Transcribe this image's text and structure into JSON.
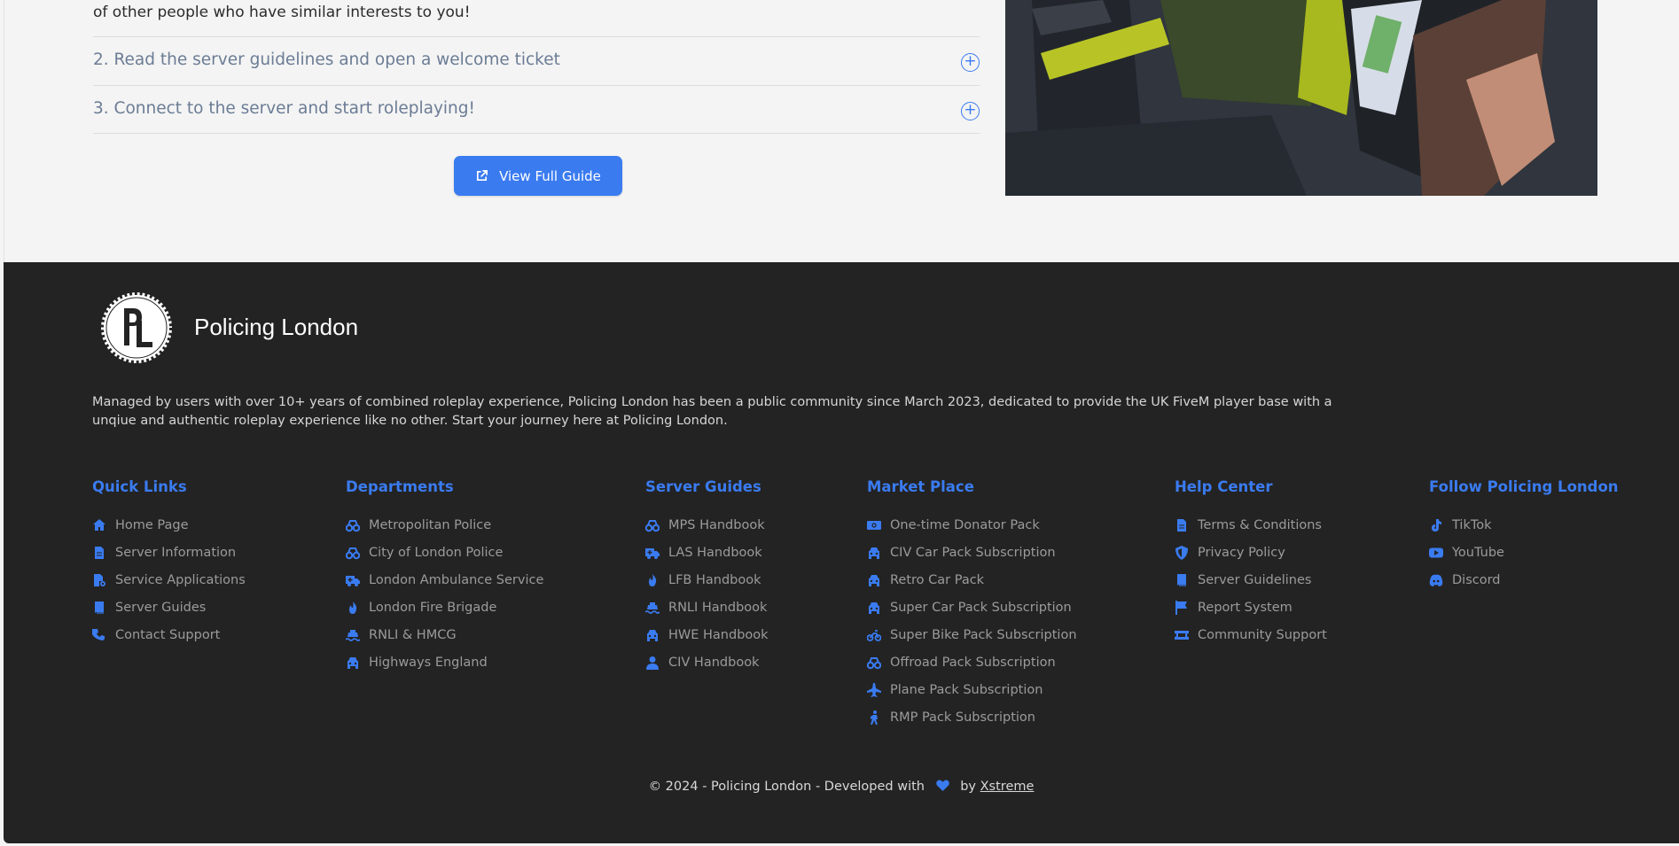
{
  "intro": {
    "tail_text": "of other people who have similar interests to you!"
  },
  "faq": [
    {
      "question": "2. Read the server guidelines and open a welcome ticket",
      "toggle": "+"
    },
    {
      "question": "3. Connect to the server and start roleplaying!",
      "toggle": "+"
    }
  ],
  "guide_button": {
    "label": "View Full Guide",
    "icon": "external-link-icon"
  },
  "footer": {
    "brand": "Policing London",
    "about": "Managed by users with over 10+ years of combined roleplay experience, Policing London has been a public community since March 2023, dedicated to provide the UK FiveM player base with a unqiue and authentic roleplay experience like no other. Start your journey here at Policing London.",
    "columns": [
      {
        "title": "Quick Links",
        "items": [
          {
            "label": "Home Page",
            "icon": "home-icon"
          },
          {
            "label": "Server Information",
            "icon": "file-icon"
          },
          {
            "label": "Service Applications",
            "icon": "file-gear-icon"
          },
          {
            "label": "Server Guides",
            "icon": "book-icon"
          },
          {
            "label": "Contact Support",
            "icon": "phone-icon"
          }
        ]
      },
      {
        "title": "Departments",
        "items": [
          {
            "label": "Metropolitan Police",
            "icon": "binoculars-icon"
          },
          {
            "label": "City of London Police",
            "icon": "binoculars-icon"
          },
          {
            "label": "London Ambulance Service",
            "icon": "truck-medical-icon"
          },
          {
            "label": "London Fire Brigade",
            "icon": "fire-icon"
          },
          {
            "label": "RNLI & HMCG",
            "icon": "ship-icon"
          },
          {
            "label": "Highways England",
            "icon": "car-icon"
          }
        ]
      },
      {
        "title": "Server Guides",
        "items": [
          {
            "label": "MPS Handbook",
            "icon": "binoculars-icon"
          },
          {
            "label": "LAS Handbook",
            "icon": "truck-medical-icon"
          },
          {
            "label": "LFB Handbook",
            "icon": "fire-icon"
          },
          {
            "label": "RNLI Handbook",
            "icon": "ship-icon"
          },
          {
            "label": "HWE Handbook",
            "icon": "car-icon"
          },
          {
            "label": "CIV Handbook",
            "icon": "user-icon"
          }
        ]
      },
      {
        "title": "Market Place",
        "items": [
          {
            "label": "One-time Donator Pack",
            "icon": "money-icon"
          },
          {
            "label": "CIV Car Pack Subscription",
            "icon": "car-icon"
          },
          {
            "label": "Retro Car Pack",
            "icon": "car-icon"
          },
          {
            "label": "Super Car Pack Subscription",
            "icon": "car-icon"
          },
          {
            "label": "Super Bike Pack Subscription",
            "icon": "motorcycle-icon"
          },
          {
            "label": "Offroad Pack Subscription",
            "icon": "binoculars-icon"
          },
          {
            "label": "Plane Pack Subscription",
            "icon": "plane-icon"
          },
          {
            "label": "RMP Pack Subscription",
            "icon": "person-walking-icon"
          }
        ]
      },
      {
        "title": "Help Center",
        "items": [
          {
            "label": "Terms & Conditions",
            "icon": "file-icon"
          },
          {
            "label": "Privacy Policy",
            "icon": "shield-icon"
          },
          {
            "label": "Server Guidelines",
            "icon": "book-icon"
          },
          {
            "label": "Report System",
            "icon": "flag-icon"
          },
          {
            "label": "Community Support",
            "icon": "ticket-icon"
          }
        ]
      },
      {
        "title": "Follow Policing London",
        "items": [
          {
            "label": "TikTok",
            "icon": "tiktok-icon"
          },
          {
            "label": "YouTube",
            "icon": "youtube-icon"
          },
          {
            "label": "Discord",
            "icon": "discord-icon"
          }
        ]
      }
    ],
    "copyright_prefix": "© 2024 - Policing London - Developed with",
    "copyright_by": "by",
    "developer": "Xstreme"
  },
  "colors": {
    "accent": "#3a7bf0",
    "footer_bg": "#232323",
    "page_bg": "#f4f4f4"
  }
}
